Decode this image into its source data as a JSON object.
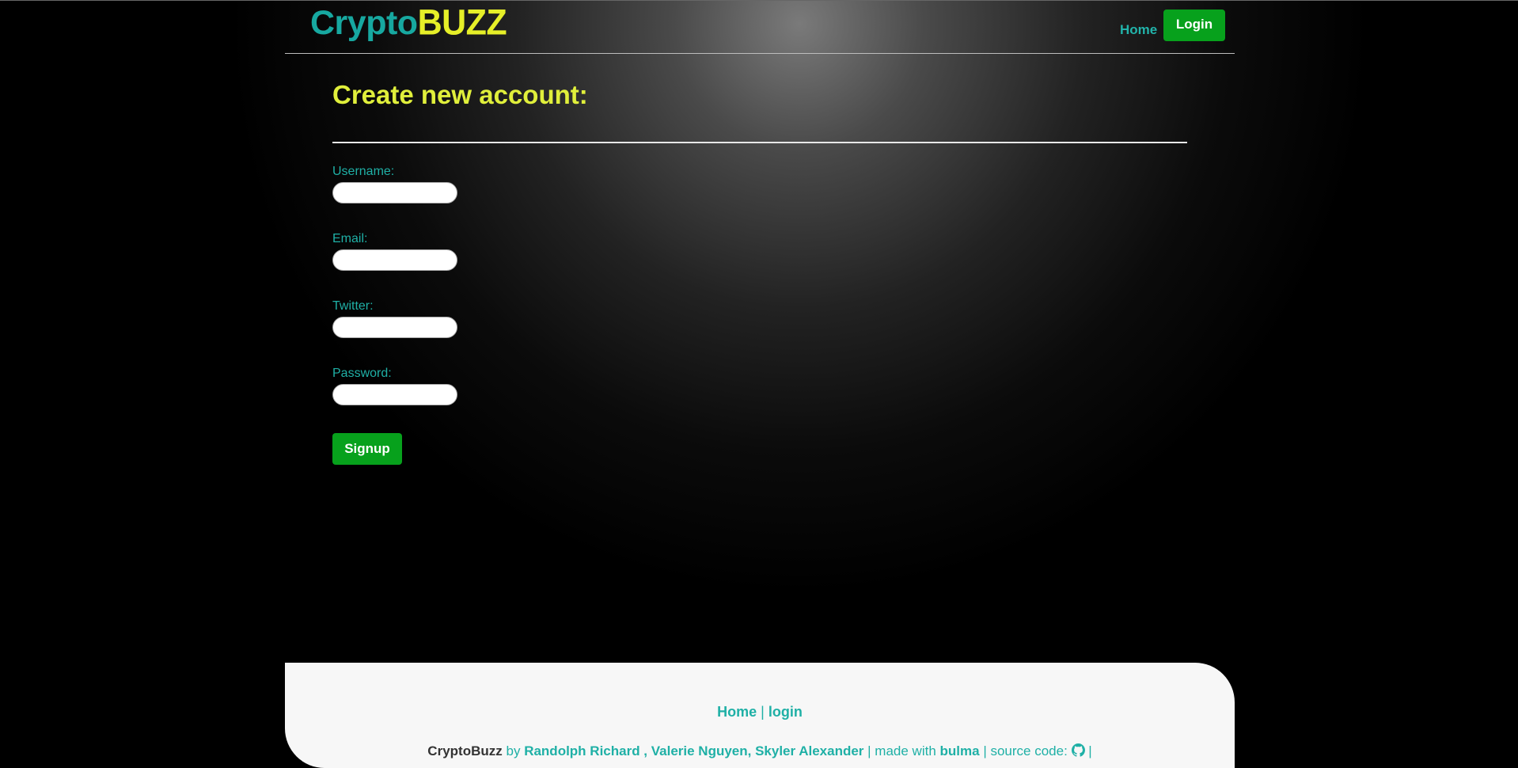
{
  "brand": {
    "logo_part1": "Crypto",
    "logo_part2": "BUZZ"
  },
  "nav": {
    "home_label": "Home",
    "login_label": "Login"
  },
  "form": {
    "title": "Create new account:",
    "fields": [
      {
        "label": "Username:",
        "value": ""
      },
      {
        "label": "Email:",
        "value": ""
      },
      {
        "label": "Twitter:",
        "value": ""
      },
      {
        "label": "Password:",
        "value": ""
      }
    ],
    "submit_label": "Signup"
  },
  "footer": {
    "home_link": "Home",
    "separator": "|",
    "login_link": "login",
    "brand": "CryptoBuzz",
    "by_text": "by",
    "authors_link": "Randolph Richard , Valerie Nguyen, Skyler Alexander",
    "made_with_text": "| made with",
    "framework_link": "bulma",
    "source_text": "| source code:",
    "source_icon": "github-icon",
    "trailing_separator": "|"
  },
  "colors": {
    "accent_teal": "#1fb0a6",
    "title_yellow": "#e0ef3b",
    "button_green": "#07a11c"
  }
}
